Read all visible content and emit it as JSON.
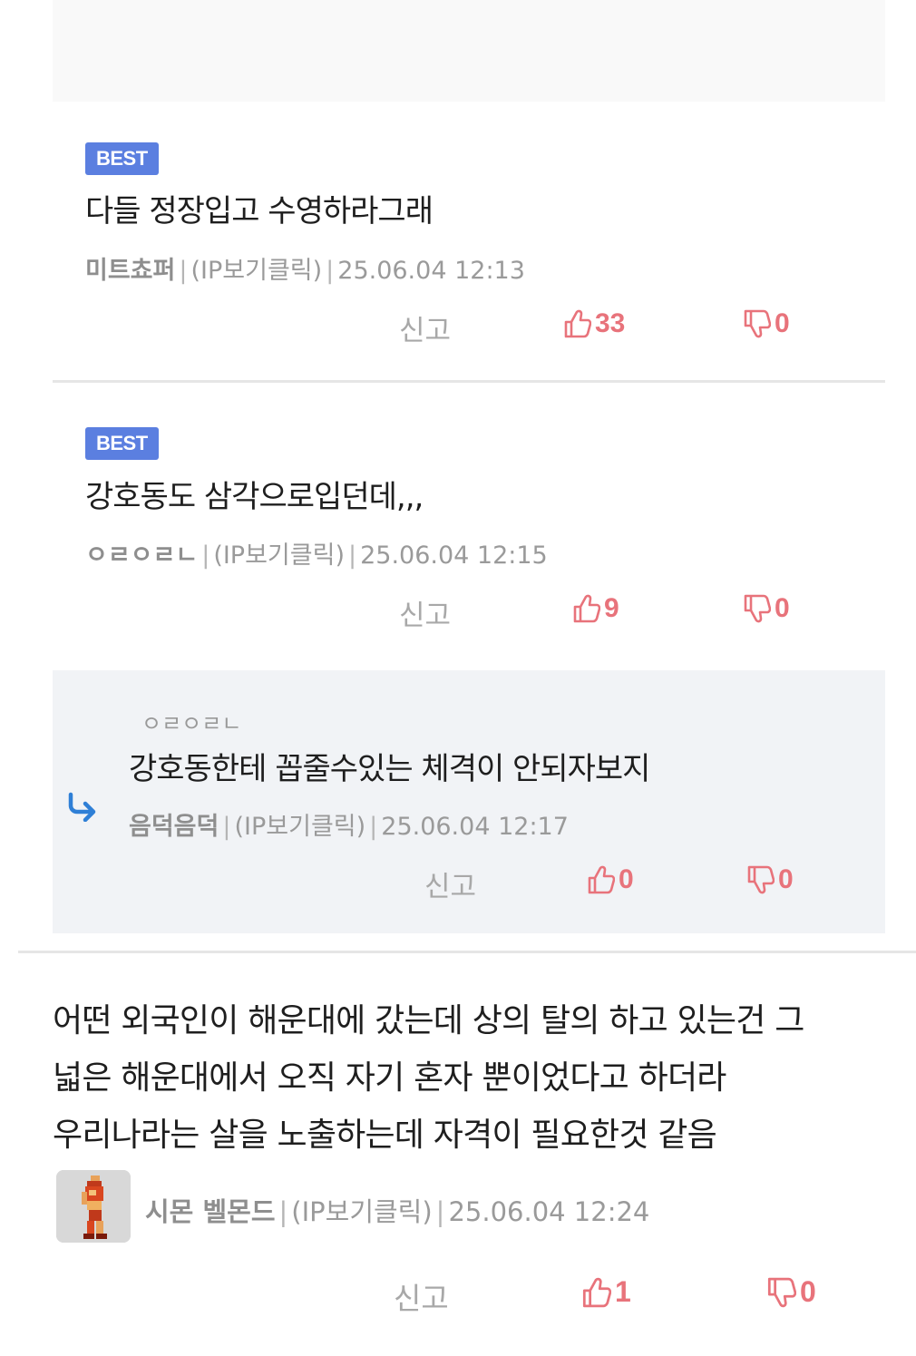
{
  "best_label": "BEST",
  "ip_label": "(IP보기클릭)",
  "report_label": "신고",
  "comments": [
    {
      "text": "다들 정장입고 수영하라그래",
      "nick": "미트쵸퍼",
      "date": "25.06.04 12:13",
      "up": "33",
      "down": "0"
    },
    {
      "text": "강호동도 삼각으로입던데,,,",
      "nick": "ㅇㄹㅇㄹㄴ",
      "date": "25.06.04 12:15",
      "up": "9",
      "down": "0"
    }
  ],
  "reply": {
    "mention": "ㅇㄹㅇㄹㄴ",
    "text": "강호동한테 꼽줄수있는 체격이 안되자보지",
    "nick": "음덕음덕",
    "date": "25.06.04 12:17",
    "up": "0",
    "down": "0"
  },
  "main_comment": {
    "lines": [
      "어떤 외국인이 해운대에 갔는데 상의 탈의 하고 있는건 그",
      "넓은 해운대에서 오직 자기 혼자 뿐이었다고 하더라",
      "우리나라는 살을 노출하는데 자격이 필요한것 같음"
    ],
    "nick": "시몬 벨몬드",
    "date": "25.06.04 12:24",
    "up": "1",
    "down": "0"
  },
  "colors": {
    "badge": "#5b7fe0",
    "vote": "#e8737b",
    "reply_bg": "#f1f3f6",
    "reply_arrow": "#2f7fd6"
  },
  "icons": [
    "thumbs-up-icon",
    "thumbs-down-icon",
    "reply-arrow-icon",
    "avatar"
  ]
}
